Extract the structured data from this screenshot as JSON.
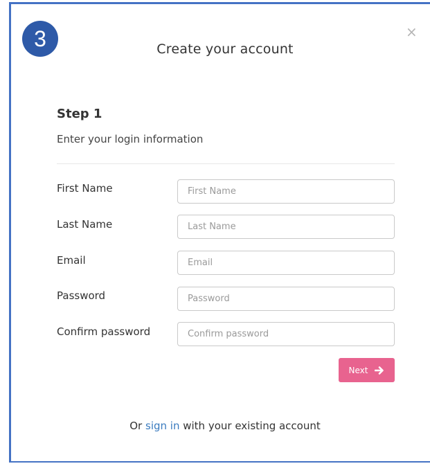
{
  "badge": {
    "number": "3"
  },
  "header": {
    "title": "Create your account",
    "close_icon": "close-icon"
  },
  "step": {
    "heading": "Step 1",
    "subtitle": "Enter your login information"
  },
  "form": {
    "fields": [
      {
        "label": "First Name",
        "placeholder": "First Name",
        "value": ""
      },
      {
        "label": "Last Name",
        "placeholder": "Last Name",
        "value": ""
      },
      {
        "label": "Email",
        "placeholder": "Email",
        "value": ""
      },
      {
        "label": "Password",
        "placeholder": "Password",
        "value": ""
      },
      {
        "label": "Confirm password",
        "placeholder": "Confirm password",
        "value": ""
      }
    ],
    "next_label": "Next",
    "next_icon": "arrow-right-icon"
  },
  "footer": {
    "prefix": "Or",
    "link": "sign in",
    "suffix": "with your existing account"
  },
  "colors": {
    "badge": "#2e5aa8",
    "frame_border": "#4472c4",
    "next_button": "#e8638f",
    "link": "#3a7bbf"
  }
}
